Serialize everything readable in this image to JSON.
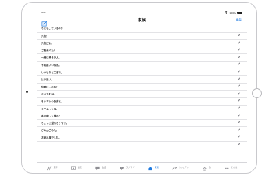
{
  "status": {
    "time": "9:41",
    "battery": "100%"
  },
  "nav": {
    "title": "家族",
    "edit_label": "編集"
  },
  "rows": [
    "なにをしているの？",
    "元気？",
    "元気だよ。",
    "ご飯食べた？",
    "一緒に帰ろうよ。",
    "それはいいねえ。",
    "いつものところで。",
    "はいはい。",
    "何時にこれる？",
    "たぶっすね。",
    "もうすぐつきます。",
    "メールしてね。",
    "寒い時して帰る？",
    "ちょっと遅れそうです。",
    "ごめんごめん。",
    "お疲れ様でした。"
  ],
  "tabs": [
    {
      "id": "kanji",
      "label": "漢字"
    },
    {
      "id": "settings",
      "label": "設定"
    },
    {
      "id": "talk",
      "label": "会話"
    },
    {
      "id": "love",
      "label": "ラブラブ"
    },
    {
      "id": "family",
      "label": "家族",
      "active": true
    },
    {
      "id": "casual",
      "label": "カジュアル"
    },
    {
      "id": "polite",
      "label": "敬"
    },
    {
      "id": "more",
      "label": "その他"
    }
  ],
  "colors": {
    "accent": "#1f7ae0",
    "inactive": "#8e8e93"
  }
}
